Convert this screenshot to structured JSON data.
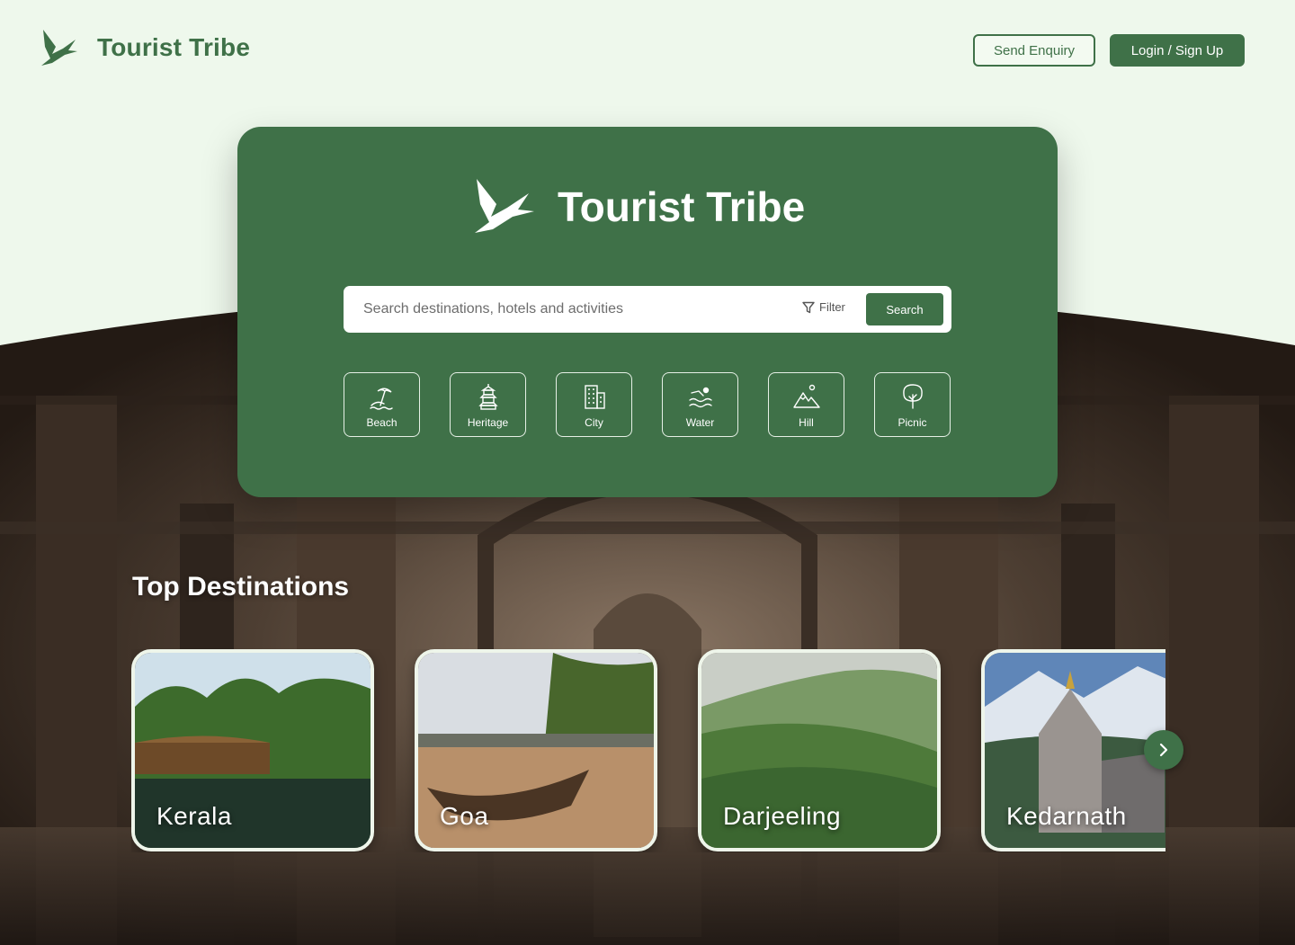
{
  "brand": {
    "name": "Tourist Tribe"
  },
  "header": {
    "enquiry_label": "Send Enquiry",
    "login_label": "Login / Sign Up"
  },
  "hero": {
    "title": "Tourist Tribe",
    "search_placeholder": "Search destinations, hotels and activities",
    "filter_label": "Filter",
    "search_label": "Search",
    "categories": [
      {
        "label": "Beach",
        "icon": "beach-icon"
      },
      {
        "label": "Heritage",
        "icon": "heritage-icon"
      },
      {
        "label": "City",
        "icon": "city-icon"
      },
      {
        "label": "Water",
        "icon": "water-icon"
      },
      {
        "label": "Hill",
        "icon": "hill-icon"
      },
      {
        "label": "Picnic",
        "icon": "picnic-icon"
      }
    ]
  },
  "destinations": {
    "title": "Top Destinations",
    "items": [
      {
        "label": "Kerala"
      },
      {
        "label": "Goa"
      },
      {
        "label": "Darjeeling"
      },
      {
        "label": "Kedarnath"
      }
    ]
  },
  "colors": {
    "primary": "#3f7148",
    "background": "#eef8ec"
  }
}
